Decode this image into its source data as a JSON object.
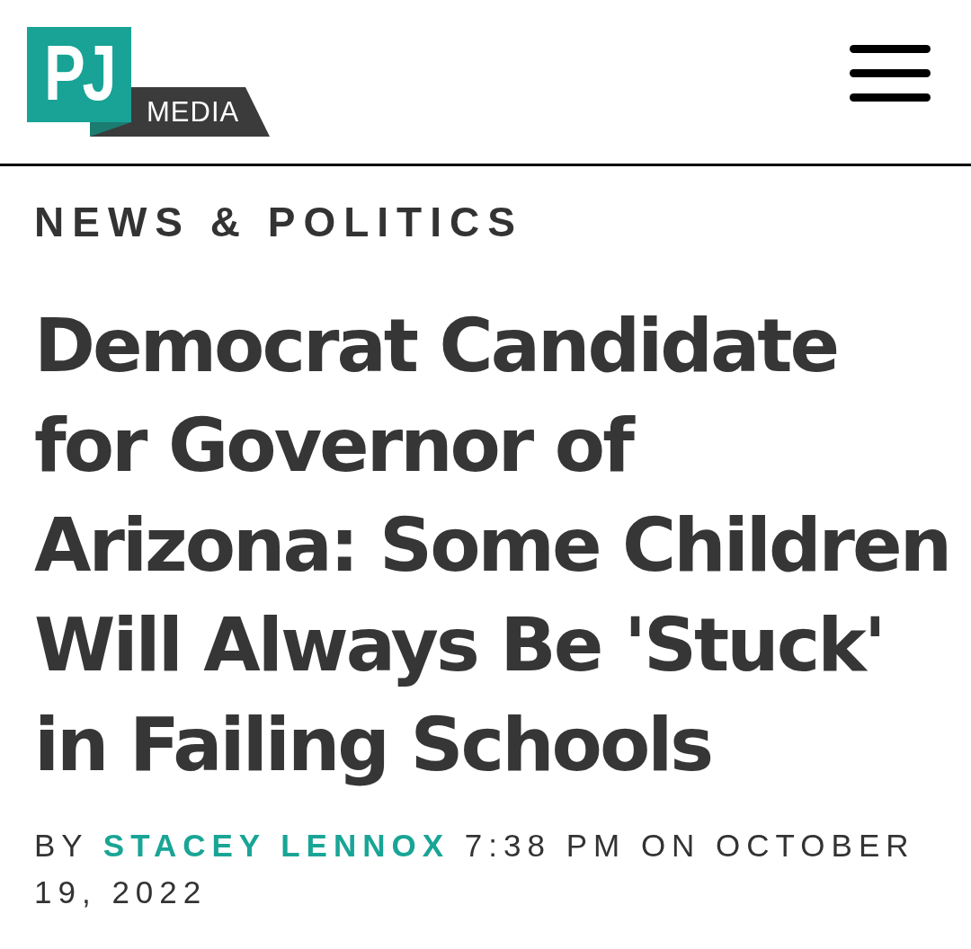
{
  "header": {
    "logo": {
      "mark": "PJ",
      "wordmark": "MEDIA"
    }
  },
  "article": {
    "category": "NEWS & POLITICS",
    "headline": "Democrat Candidate for Governor of Arizona: Some Children Will Always Be 'Stuck' in Failing Schools",
    "byline": "BY **STACEY LENNOX** 7:38 PM ON OCTOBER 19, 2022"
  }
}
